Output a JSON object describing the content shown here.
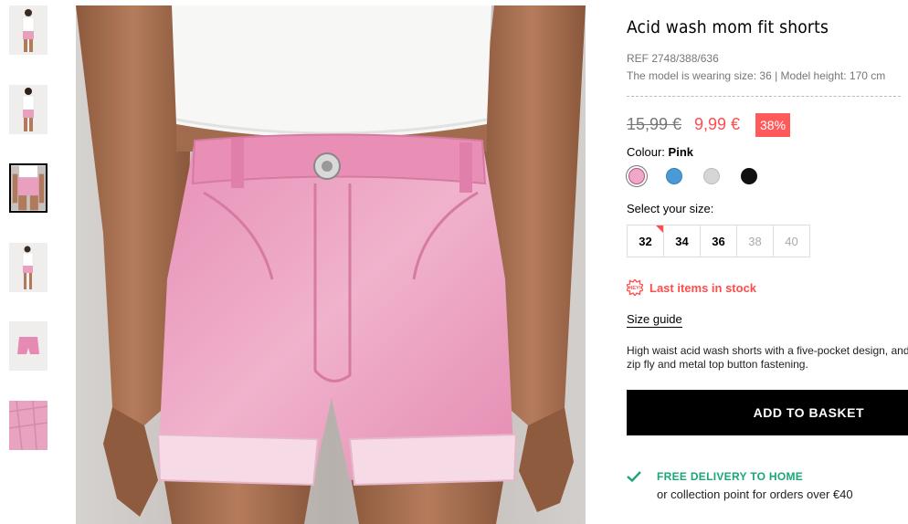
{
  "product": {
    "title": "Acid wash mom fit shorts",
    "ref": "REF 2748/388/636",
    "model_info": "The model is wearing size: 36 | Model height: 170 cm",
    "old_price": "15,99 €",
    "new_price": "9,99 €",
    "discount": "38%",
    "colour_label": "Colour:",
    "colour_value": "Pink",
    "colours": [
      {
        "name": "pink-swatch",
        "hex": "#f0a8c8",
        "selected": true
      },
      {
        "name": "blue-swatch",
        "hex": "#4b9ad6",
        "selected": false
      },
      {
        "name": "grey-swatch",
        "hex": "#d6d6d6",
        "selected": false
      },
      {
        "name": "black-swatch",
        "hex": "#111111",
        "selected": false
      }
    ],
    "size_label": "Select your size:",
    "sizes": [
      {
        "label": "32",
        "available": true,
        "low_stock": true
      },
      {
        "label": "34",
        "available": true,
        "low_stock": false
      },
      {
        "label": "36",
        "available": true,
        "low_stock": false
      },
      {
        "label": "38",
        "available": false,
        "low_stock": false
      },
      {
        "label": "40",
        "available": false,
        "low_stock": false
      }
    ],
    "stock_icon_text": "HEY!",
    "stock_message": "Last items in stock",
    "size_guide": "Size guide",
    "description": "High waist acid wash shorts with a five-pocket design, and zip fly and metal top button fastening.",
    "add_to_basket": "ADD TO BASKET",
    "delivery_title": "FREE DELIVERY TO HOME",
    "delivery_sub": "or collection point for orders over €40"
  },
  "thumbnails": [
    {
      "name": "thumbnail-front-full",
      "active": false
    },
    {
      "name": "thumbnail-back-full",
      "active": false
    },
    {
      "name": "thumbnail-detail-front",
      "active": true
    },
    {
      "name": "thumbnail-side-full",
      "active": false
    },
    {
      "name": "thumbnail-product-flat",
      "active": false
    },
    {
      "name": "thumbnail-fabric-detail",
      "active": false
    }
  ],
  "colors": {
    "accent_red": "#ff4c4c",
    "delivery_green": "#1aa57a",
    "button_black": "#000000",
    "shorts_pink": "#e9a0bf"
  }
}
